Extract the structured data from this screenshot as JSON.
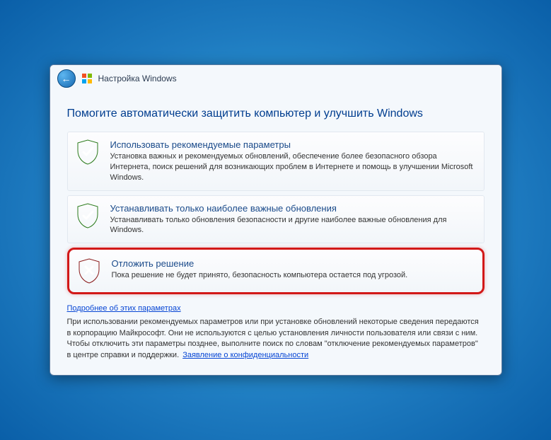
{
  "header": {
    "title": "Настройка Windows",
    "back_icon": "back-arrow-icon",
    "flag_icon": "windows-flag-icon"
  },
  "headline": "Помогите автоматически защитить компьютер и улучшить Windows",
  "options": [
    {
      "icon": "shield-check-icon",
      "title": "Использовать рекомендуемые параметры",
      "desc": "Установка важных и рекомендуемых обновлений, обеспечение более безопасного обзора Интернета, поиск решений для возникающих проблем в Интернете и помощь в улучшении Microsoft Windows.",
      "highlighted": false
    },
    {
      "icon": "shield-check-icon",
      "title": "Устанавливать только наиболее важные обновления",
      "desc": "Устанавливать только обновления безопасности и другие наиболее важные обновления для Windows.",
      "highlighted": false
    },
    {
      "icon": "shield-x-icon",
      "title": "Отложить решение",
      "desc": "Пока решение не будет принято, безопасность компьютера остается под угрозой.",
      "highlighted": true
    }
  ],
  "footer": {
    "more_link": "Подробнее об этих параметрах",
    "text": "При использовании рекомендуемых параметров или при установке обновлений некоторые сведения передаются в корпорацию Майкрософт. Они не используются с целью установления личности пользователя или связи с ним. Чтобы отключить эти параметры позднее, выполните поиск по словам \"отключение рекомендуемых параметров\" в центре справки и поддержки.",
    "privacy_link": "Заявление о конфиденциальности"
  }
}
